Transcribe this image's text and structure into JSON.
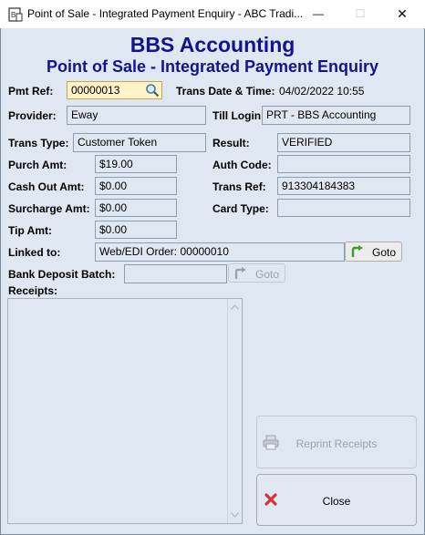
{
  "window": {
    "title": "Point of Sale - Integrated Payment Enquiry - ABC Tradi...",
    "minimize": "—",
    "maximize": "☐",
    "close": "✕"
  },
  "header": {
    "company": "BBS Accounting",
    "subtitle": "Point of Sale - Integrated Payment Enquiry"
  },
  "form": {
    "pmt_ref_label": "Pmt Ref:",
    "pmt_ref_value": "00000013",
    "trans_datetime_label": "Trans Date & Time:",
    "trans_datetime_value": "04/02/2022 10:55",
    "provider_label": "Provider:",
    "provider_value": "Eway",
    "till_login_label": "Till Login:",
    "till_login_value": "PRT - BBS Accounting",
    "trans_type_label": "Trans Type:",
    "trans_type_value": "Customer Token",
    "result_label": "Result:",
    "result_value": "VERIFIED",
    "purch_amt_label": "Purch Amt:",
    "purch_amt_value": "$19.00",
    "auth_code_label": "Auth Code:",
    "auth_code_value": "",
    "cash_out_label": "Cash Out Amt:",
    "cash_out_value": "$0.00",
    "trans_ref_label": "Trans Ref:",
    "trans_ref_value": "913304184383",
    "surcharge_label": "Surcharge Amt:",
    "surcharge_value": "$0.00",
    "card_type_label": "Card Type:",
    "card_type_value": "",
    "tip_label": "Tip Amt:",
    "tip_value": "$0.00",
    "linked_label": "Linked to:",
    "linked_value": "Web/EDI Order: 00000010",
    "goto_label": "Goto",
    "bank_deposit_label": "Bank Deposit Batch:",
    "bank_deposit_value": "",
    "goto_disabled_label": "Goto",
    "receipts_label": "Receipts:"
  },
  "actions": {
    "reprint_label": "Reprint Receipts",
    "close_label": "Close"
  },
  "icons": {
    "search": "search-icon",
    "goto": "goto-arrow-icon",
    "printer": "printer-icon",
    "close_x": "close-x-icon"
  },
  "colors": {
    "header_text": "#14148a",
    "background": "#dfe7f3",
    "goto_green": "#3a9c2a",
    "close_red": "#d43434"
  }
}
